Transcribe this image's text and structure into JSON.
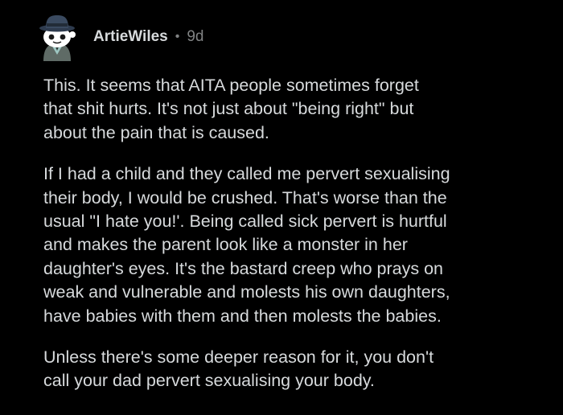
{
  "comment": {
    "author": "ArtieWiles",
    "separator": "•",
    "age": "9d",
    "paragraphs": [
      "This. It seems that AITA people sometimes forget\nthat shit hurts. It's not just about \"being right\" but\nabout the pain that is caused.",
      "If I had a child and they called me pervert sexualising\ntheir body, I would be crushed. That's worse than the\nusual \"I hate you!'. Being called sick pervert is hurtful\nand makes the parent look like a monster in her\ndaughter's eyes. It's the bastard creep who prays on\nweak and vulnerable and molests his own daughters,\nhave babies with them and then molests the babies.",
      "Unless there's some deeper reason for it, you don't\ncall your dad pervert sexualising your body."
    ]
  },
  "colors": {
    "background": "#000000",
    "text": "#d7dadc",
    "muted": "#818384"
  },
  "icons": {
    "avatar": "snoo-avatar-with-hat-icon"
  }
}
